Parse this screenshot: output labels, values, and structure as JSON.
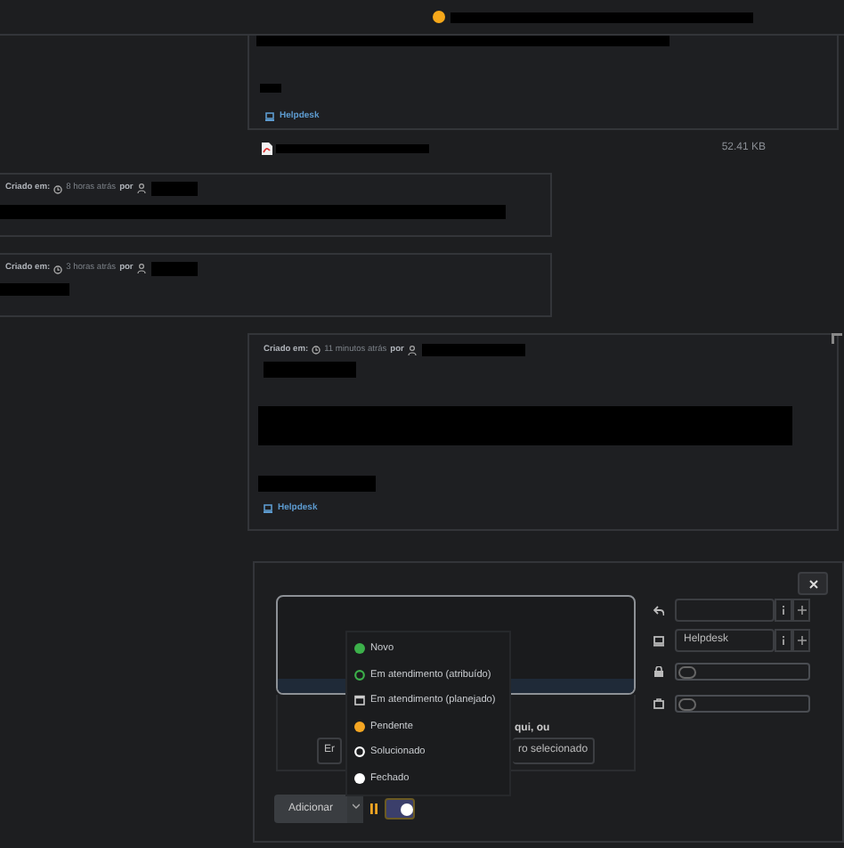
{
  "top_item": {
    "color": "#f6a81a"
  },
  "first_card": {
    "source": "Helpdesk"
  },
  "attachment": {
    "size": "52.41 KB"
  },
  "entries": [
    {
      "created_label": "Criado em:",
      "time": "8 horas atrás",
      "by_label": "por"
    },
    {
      "created_label": "Criado em:",
      "time": "3 horas atrás",
      "by_label": "por"
    },
    {
      "created_label": "Criado em:",
      "time": "11 minutos atrás",
      "by_label": "por",
      "source": "Helpdesk"
    }
  ],
  "form": {
    "status_menu": [
      {
        "label": "Novo",
        "kind": "filled",
        "color": "#3cb04a"
      },
      {
        "label": "Em atendimento (atribuído)",
        "kind": "ring",
        "color": "#3cb04a"
      },
      {
        "label": "Em atendimento (planejado)",
        "kind": "calendar"
      },
      {
        "label": "Pendente",
        "kind": "filled",
        "color": "#f5a623"
      },
      {
        "label": "Solucionado",
        "kind": "ring",
        "color": "#ffffff"
      },
      {
        "label": "Fechado",
        "kind": "filled",
        "color": "#ffffff"
      }
    ],
    "left_button": "Er",
    "dropzone_text": "qui, ou",
    "file_button": "ro selecionado",
    "source_select": "Helpdesk",
    "toggles": [
      {
        "on": false
      },
      {
        "on": false
      }
    ],
    "submit": "Adicionar",
    "private_toggle": {
      "on": true
    }
  }
}
